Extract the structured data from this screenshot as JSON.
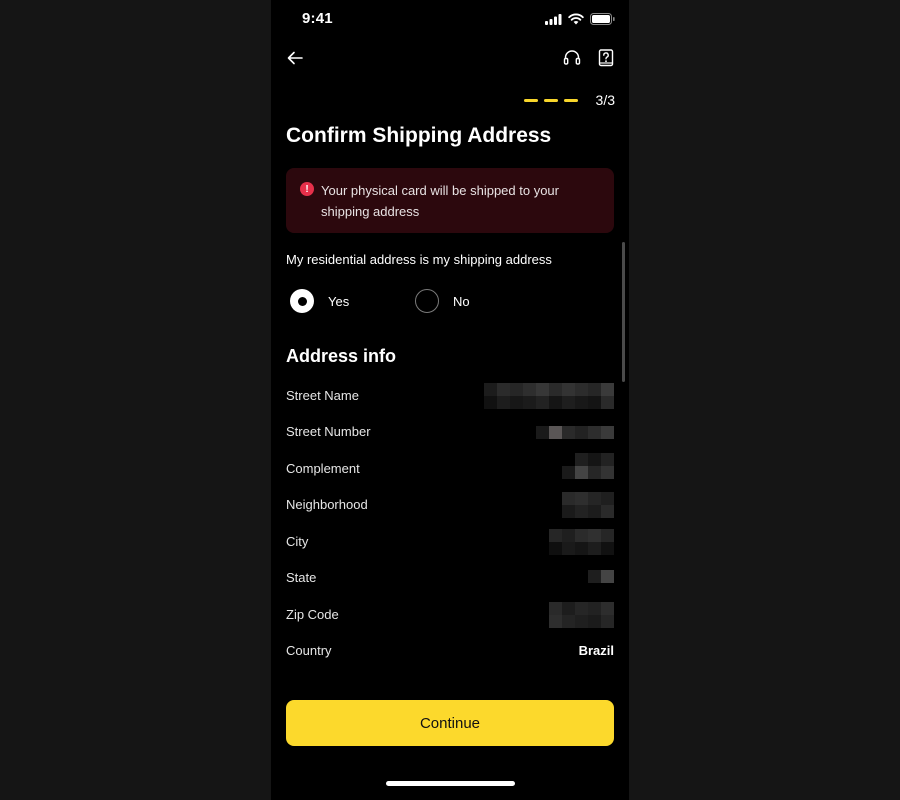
{
  "status_bar": {
    "time": "9:41"
  },
  "nav": {
    "back_icon": "arrow-left-icon",
    "support_icon": "headset-icon",
    "help_icon": "help-book-icon"
  },
  "progress": {
    "step_text": "3/3",
    "total_steps": 3,
    "completed_steps": 3,
    "color": "#f9d62b"
  },
  "page": {
    "title": "Confirm Shipping Address"
  },
  "alert": {
    "icon": "exclamation-circle-icon",
    "text": "Your physical card will be shipped to your shipping address",
    "background": "#2c080d",
    "icon_color": "#e6304a"
  },
  "residential_question": {
    "label": "My residential address is my shipping address",
    "options": [
      {
        "label": "Yes",
        "selected": true
      },
      {
        "label": "No",
        "selected": false
      }
    ]
  },
  "address_info": {
    "title": "Address info",
    "fields": [
      {
        "label": "Street Name",
        "value": "",
        "redacted": true
      },
      {
        "label": "Street Number",
        "value": "",
        "redacted": true
      },
      {
        "label": "Complement",
        "value": "",
        "redacted": true
      },
      {
        "label": "Neighborhood",
        "value": "",
        "redacted": true
      },
      {
        "label": "City",
        "value": "",
        "redacted": true
      },
      {
        "label": "State",
        "value": "",
        "redacted": true
      },
      {
        "label": "Zip Code",
        "value": "",
        "redacted": true
      },
      {
        "label": "Country",
        "value": "Brazil",
        "redacted": false
      }
    ]
  },
  "footer": {
    "continue_label": "Continue",
    "accent": "#fcd92c"
  }
}
